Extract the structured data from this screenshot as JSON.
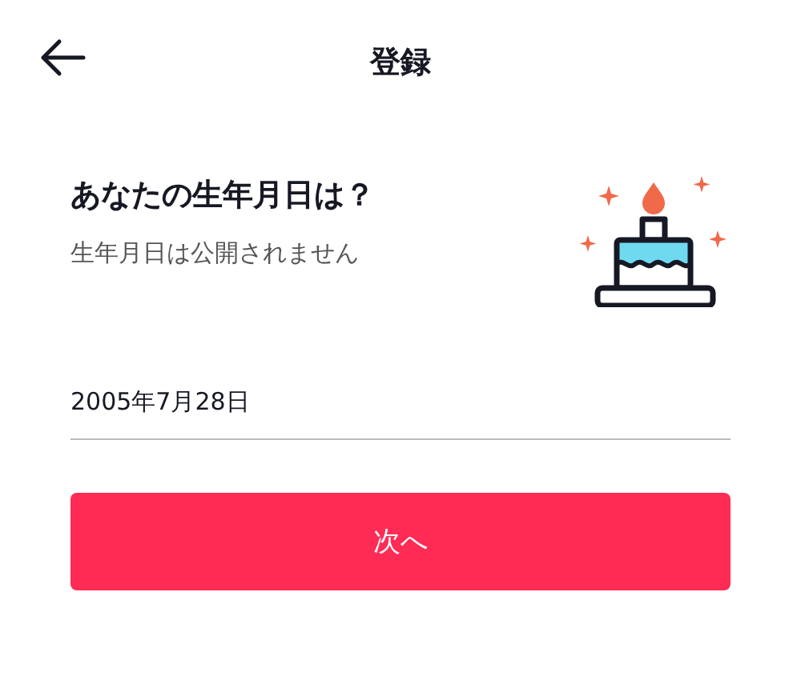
{
  "header": {
    "title": "登録"
  },
  "question": {
    "title": "あなたの生年月日は？",
    "subtitle": "生年月日は公開されません"
  },
  "birthday_field": {
    "value": "2005年7月28日"
  },
  "next_button": {
    "label": "次へ"
  }
}
